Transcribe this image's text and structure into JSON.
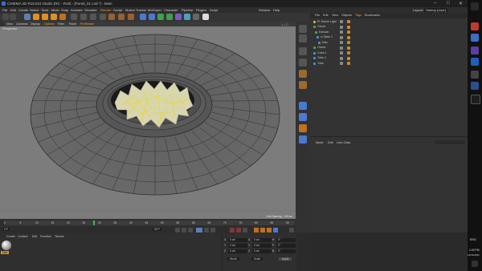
{
  "window": {
    "title": "CINEMA 4D R19.024 Studio (RC - R19) - [Portal_01.c4d *] - Main",
    "layout_label": "Layout:",
    "layout_value": "Startup (User)"
  },
  "menu": [
    "File",
    "Edit",
    "Create",
    "Select",
    "Tools",
    "Mesh",
    "Snap",
    "Animate",
    "Simulate",
    "Render",
    "Sculpt",
    "Motion Tracker",
    "MoGraph",
    "Character",
    "Pipeline",
    "Plugins",
    "Script",
    "Window",
    "Help"
  ],
  "viewport_menu": [
    "View",
    "Cameras",
    "Display",
    "Options",
    "Filter",
    "Panel",
    "ProRender"
  ],
  "viewport": {
    "label": "Perspective",
    "grid_spacing": "Grid Spacing : 100 cm"
  },
  "object_panel": {
    "tabs": [
      "File",
      "Edit",
      "View",
      "Objects",
      "Tags",
      "Bookmarks"
    ],
    "objects": [
      {
        "name": "Pr Scene Light",
        "color": "#e0b030"
      },
      {
        "name": "Cloner",
        "color": "#3fb04a"
      },
      {
        "name": "Extrude",
        "color": "#3fb04a"
      },
      {
        "name": "n-Sides 1",
        "color": "#4a90d9"
      },
      {
        "name": "Disc",
        "color": "#4a90d9"
      },
      {
        "name": "Cloner",
        "color": "#3fb04a"
      },
      {
        "name": "Cube.1",
        "color": "#4a90d9"
      },
      {
        "name": "Tube.1",
        "color": "#4a90d9"
      },
      {
        "name": "Tube",
        "color": "#4a90d9"
      }
    ]
  },
  "attributes_panel": {
    "tabs": [
      "Mode",
      "Edit",
      "User Data"
    ]
  },
  "timeline": {
    "ticks": [
      "0",
      "5",
      "10",
      "15",
      "20",
      "25",
      "30",
      "35",
      "40",
      "45",
      "50",
      "55",
      "60",
      "65",
      "70",
      "75",
      "80",
      "85",
      "90"
    ],
    "current_frame": "0 F",
    "end_frame": "90 F"
  },
  "material_panel": {
    "tabs": [
      "Create",
      "Context",
      "Edit",
      "Function",
      "Texture"
    ],
    "material_name": "Mat"
  },
  "coordinates": {
    "rows": [
      {
        "axis": "X",
        "pos": "0 cm",
        "axis2": "X",
        "size": "0 cm",
        "axis3": "H",
        "rot": "0°"
      },
      {
        "axis": "Y",
        "pos": "0 cm",
        "axis2": "Y",
        "size": "0 cm",
        "axis3": "P",
        "rot": "0°"
      },
      {
        "axis": "Z",
        "pos": "0 cm",
        "axis2": "Z",
        "size": "0 cm",
        "axis3": "B",
        "rot": "0°"
      }
    ],
    "mode": "World",
    "scale_mode": "Scale",
    "apply": "Apply"
  },
  "taskbar": {
    "lang": "ENG",
    "time": "1:00 PM",
    "date": "12/11/2021"
  },
  "colors": {
    "accent": "#f0a020",
    "selection": "#e8d760",
    "viewport_bg": "#7c7c7c"
  }
}
